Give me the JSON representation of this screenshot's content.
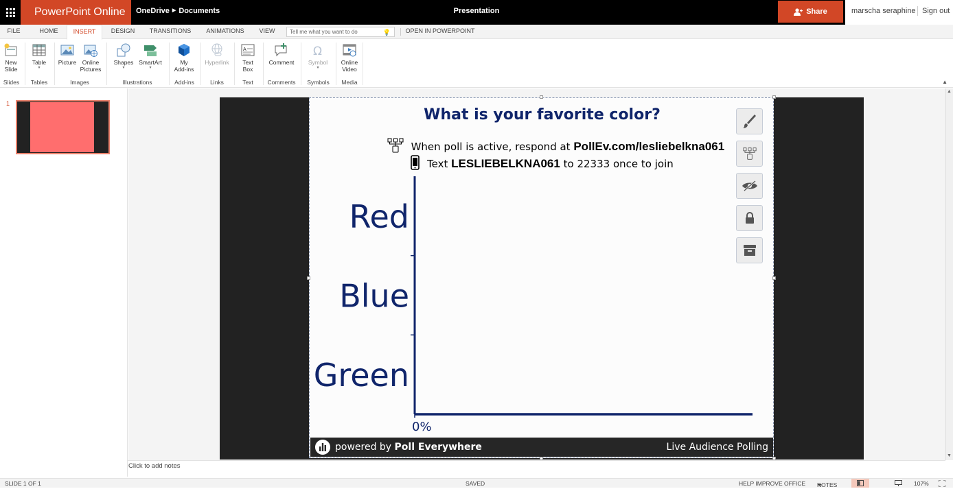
{
  "topbar": {
    "app_name": "PowerPoint Online",
    "breadcrumb": [
      "OneDrive",
      "Documents"
    ],
    "doc_title": "Presentation",
    "share_label": "Share",
    "user_name": "marscha seraphine",
    "sign_out": "Sign out"
  },
  "tabs": [
    {
      "label": "FILE"
    },
    {
      "label": "HOME"
    },
    {
      "label": "INSERT"
    },
    {
      "label": "DESIGN"
    },
    {
      "label": "TRANSITIONS"
    },
    {
      "label": "ANIMATIONS"
    },
    {
      "label": "VIEW"
    }
  ],
  "tell_me_placeholder": "Tell me what you want to do",
  "open_in_app": "OPEN IN POWERPOINT",
  "ribbon": {
    "buttons": {
      "new_slide": [
        "New",
        "Slide"
      ],
      "table": [
        "Table"
      ],
      "picture": [
        "Picture"
      ],
      "online_pictures": [
        "Online",
        "Pictures"
      ],
      "shapes": [
        "Shapes"
      ],
      "smartart": [
        "SmartArt"
      ],
      "my_addins": [
        "My",
        "Add-ins"
      ],
      "hyperlink": [
        "Hyperlink"
      ],
      "text_box": [
        "Text",
        "Box"
      ],
      "comment": [
        "Comment"
      ],
      "symbol": [
        "Symbol"
      ],
      "online_video": [
        "Online",
        "Video"
      ]
    },
    "groups": {
      "slides": "Slides",
      "tables": "Tables",
      "images": "Images",
      "illustrations": "Illustrations",
      "addins": "Add-ins",
      "links": "Links",
      "text": "Text",
      "comments": "Comments",
      "symbols": "Symbols",
      "media": "Media"
    }
  },
  "thumbnail": {
    "number": "1"
  },
  "poll": {
    "title": "What is your favorite color?",
    "line1_prefix": "When poll is active, respond at",
    "line1_url": "PollEv.com/lesliebelkna061",
    "line2_prefix": "Text",
    "line2_code": "LESLIEBELKNA061",
    "line2_mid": "to",
    "line2_number": "22333",
    "line2_suffix": "once to join",
    "footer_powered": "powered by",
    "footer_brand": "Poll Everywhere",
    "footer_right": "Live Audience Polling"
  },
  "chart_data": {
    "type": "bar",
    "orientation": "horizontal",
    "categories": [
      "Red",
      "Blue",
      "Green"
    ],
    "values": [
      0,
      0,
      0
    ],
    "xlim": [
      0,
      100
    ],
    "tick_labels": [
      "0%"
    ],
    "bar_color": "#10256b",
    "label_color": "#10256b"
  },
  "notes_placeholder": "Click to add notes",
  "status": {
    "slide_info": "SLIDE 1 OF 1",
    "saved": "SAVED",
    "help": "HELP IMPROVE OFFICE",
    "notes": "NOTES",
    "zoom": "107%"
  },
  "colors": {
    "accent": "#d24726",
    "poll_navy": "#10256b"
  }
}
